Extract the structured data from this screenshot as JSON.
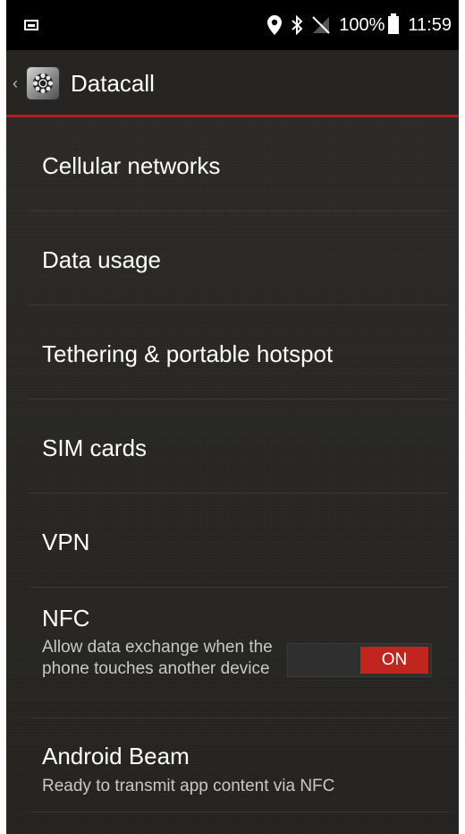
{
  "status_bar": {
    "icons": [
      "image-notification-icon",
      "location-pin-icon",
      "bluetooth-icon",
      "no-sim-icon",
      "battery-full-icon"
    ],
    "battery_percent": "100%",
    "time": "11:59"
  },
  "action_bar": {
    "title": "Datacall",
    "icon": "settings-gear-icon"
  },
  "items": [
    {
      "title": "Cellular networks"
    },
    {
      "title": "Data usage"
    },
    {
      "title": "Tethering & portable hotspot"
    },
    {
      "title": "SIM cards"
    },
    {
      "title": "VPN"
    },
    {
      "title": "NFC",
      "summary": "Allow data exchange when the phone touches another device",
      "toggle": {
        "state": "ON"
      }
    },
    {
      "title": "Android Beam",
      "summary": "Ready to transmit app content via NFC"
    }
  ],
  "colors": {
    "accent": "#b41e1e",
    "toggle_on": "#c0261d",
    "status_bar": "#000000",
    "background": "#272624"
  }
}
